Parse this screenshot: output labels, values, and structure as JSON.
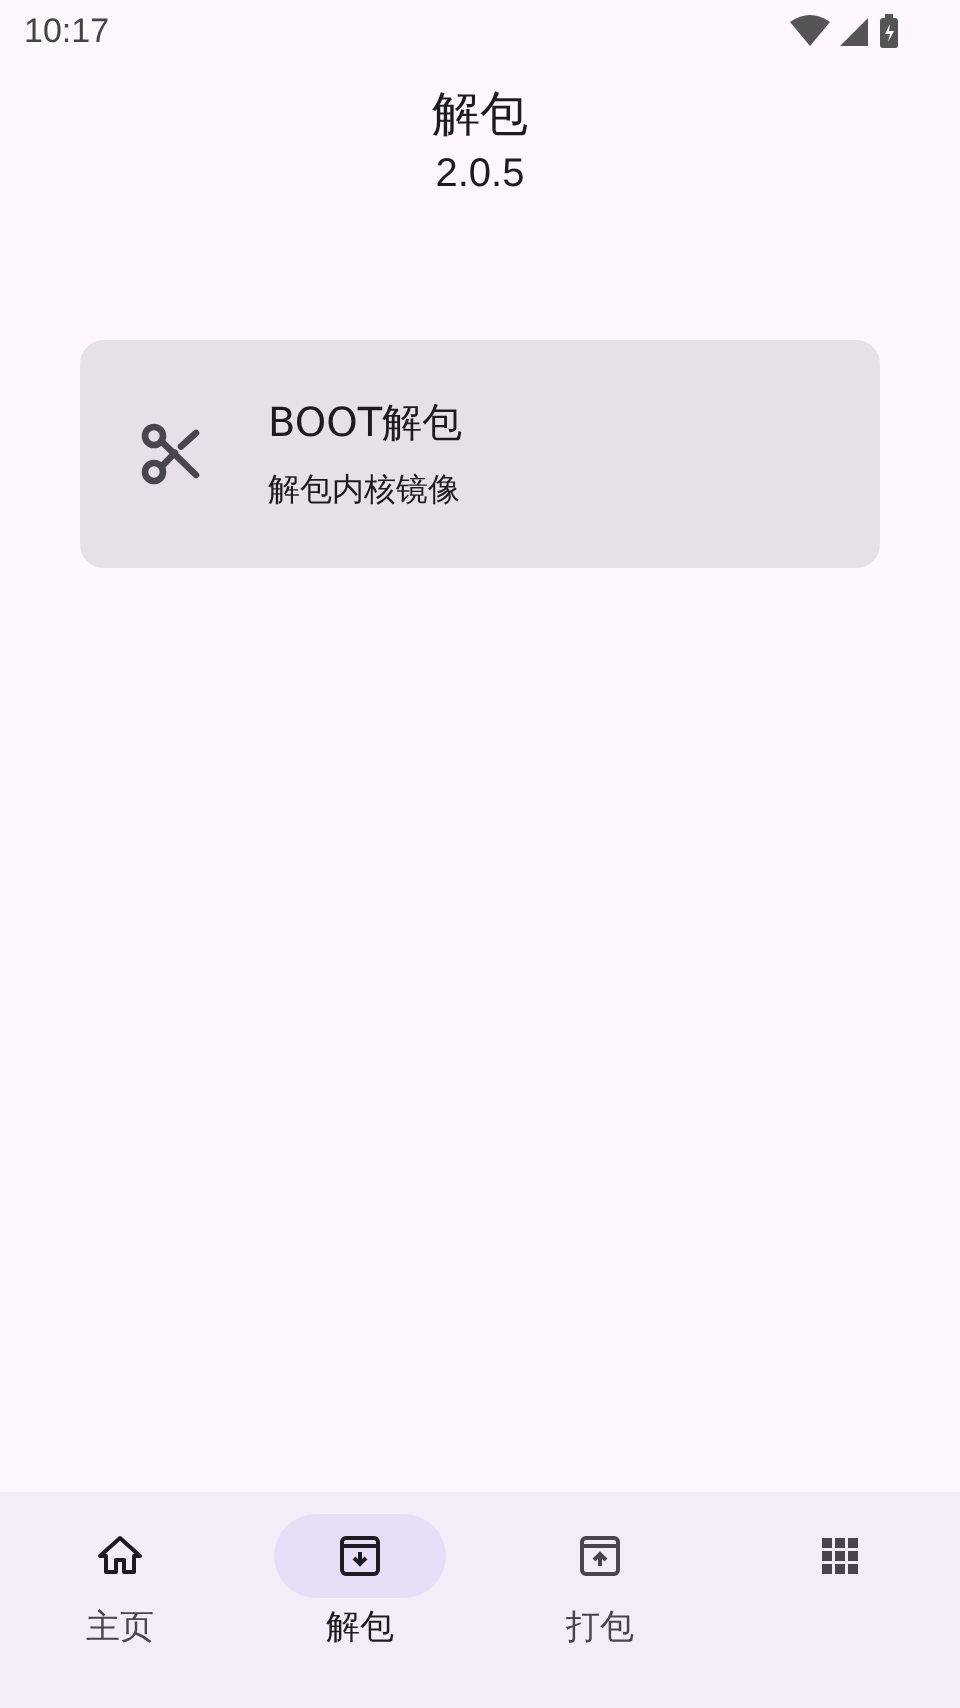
{
  "status_bar": {
    "time": "10:17"
  },
  "header": {
    "title": "解包",
    "version": "2.0.5"
  },
  "cards": [
    {
      "kind": "scissors",
      "title": "BOOT解包",
      "subtitle": "解包内核镜像"
    }
  ],
  "bottom_nav": [
    {
      "kind": "home",
      "label": "主页",
      "selected": false
    },
    {
      "kind": "unpack",
      "label": "解包",
      "selected": true
    },
    {
      "kind": "pack",
      "label": "打包",
      "selected": false
    },
    {
      "kind": "grid",
      "selected": false
    }
  ]
}
